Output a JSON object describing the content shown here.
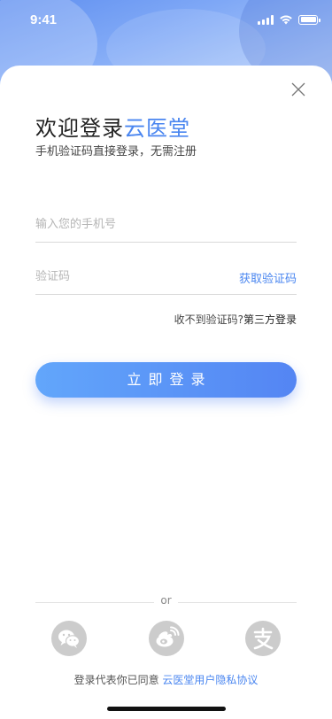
{
  "status_bar": {
    "time": "9:41"
  },
  "login": {
    "title_prefix": "欢迎登录",
    "title_brand": "云医堂",
    "subtitle": "手机验证码直接登录，无需注册",
    "phone_placeholder": "输入您的手机号",
    "code_placeholder": "验证码",
    "get_code_label": "获取验证码",
    "no_code_text": "收不到验证码?",
    "third_party_label": "第三方登录",
    "login_button_label": "立即登录"
  },
  "footer": {
    "or_text": "or",
    "social_icons": [
      "wechat-icon",
      "weibo-icon",
      "alipay-icon"
    ],
    "agree_prefix": "登录代表你已同意",
    "agreement_link": "云医堂用户隐私协议"
  },
  "colors": {
    "accent": "#4a86f0",
    "button_gradient_start": "#62a6fb",
    "button_gradient_end": "#5485f3",
    "social_icon_bg": "#cccccc"
  }
}
